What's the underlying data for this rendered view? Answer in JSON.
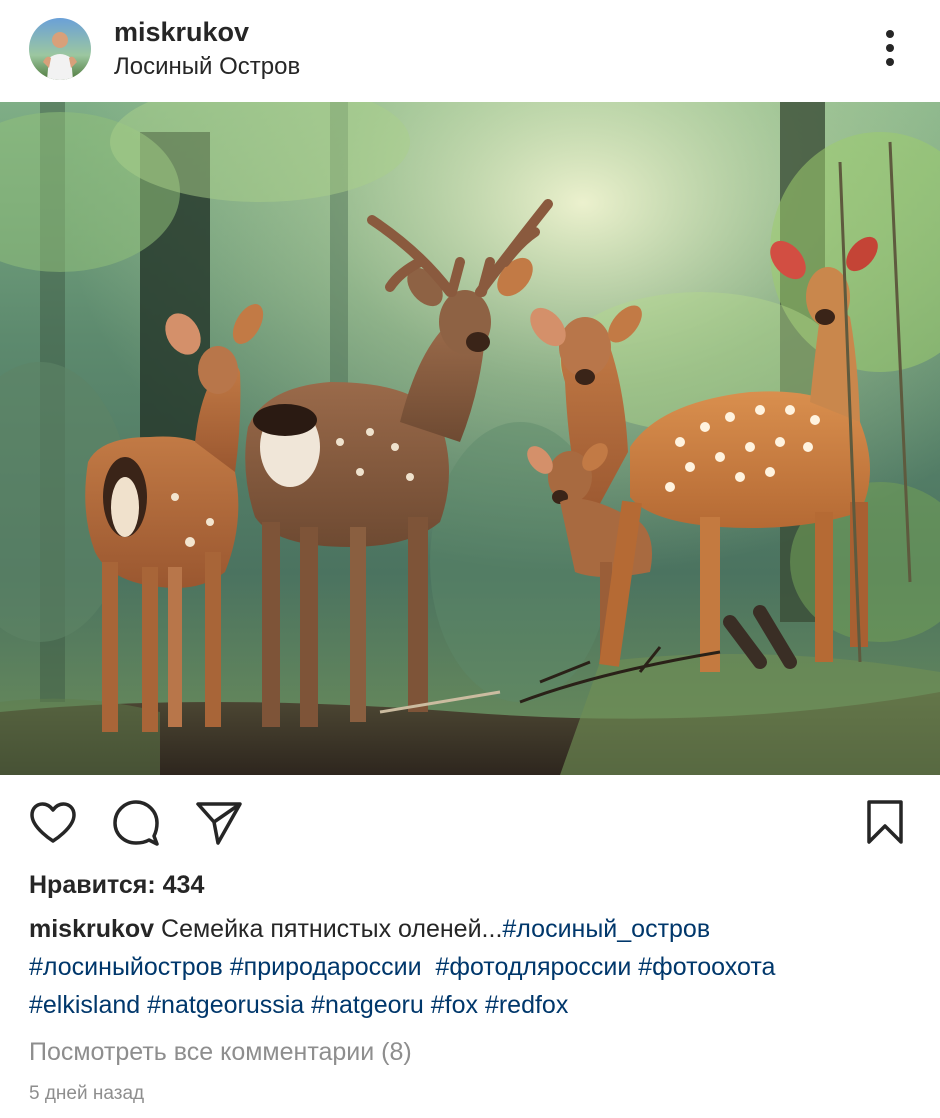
{
  "post": {
    "username": "miskrukov",
    "location": "Лосиный Остров",
    "more_icon": "more-vertical-icon",
    "photo": {
      "subject": "spotted-deer-family-in-forest",
      "colors": {
        "forest_dark": "#2f4a35",
        "forest_light": "#a9c89a",
        "deer_fur": "#b46a3c",
        "ground": "#3a2f25"
      }
    },
    "actions": {
      "like_icon": "heart-icon",
      "comment_icon": "comment-icon",
      "share_icon": "paper-plane-icon",
      "save_icon": "bookmark-icon"
    },
    "likes_text": "Нравится: 434",
    "caption": {
      "author": "miskrukov",
      "text": "Семейка пятнистых оленей...",
      "hashtags_line1": [
        "#лосиный_остров"
      ],
      "hashtags_line2": [
        "#лосиныйостров",
        "#природароссии",
        "#фотодляроссии",
        "#фотоохота"
      ],
      "hashtags_line3": [
        "#elkisland",
        "#natgeorussia",
        "#natgeoru",
        "#fox",
        "#redfox"
      ]
    },
    "view_comments": "Посмотреть все комментарии (8)",
    "timestamp": "5 дней назад",
    "colors": {
      "text": "#262626",
      "link": "#00376b",
      "muted": "#8e8e8e",
      "background": "#ffffff"
    }
  }
}
